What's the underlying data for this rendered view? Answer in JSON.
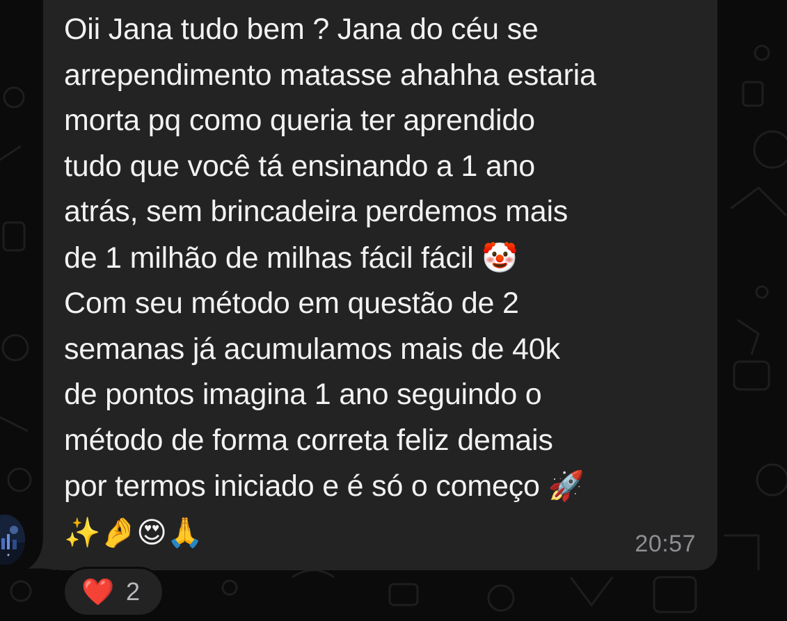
{
  "message": {
    "lines": [
      "Oii Jana tudo bem ? Jana do céu se",
      "arrependimento matasse ahahha estaria",
      "morta pq como queria ter aprendido",
      "tudo que você tá ensinando a 1 ano",
      "atrás, sem brincadeira perdemos mais",
      "de 1 milhão de milhas fácil fácil",
      "Com seu método em questão de 2",
      "semanas já acumulamos mais de 40k",
      "de pontos imagina 1 ano seguindo o",
      "método de forma correta feliz demais",
      "por termos iniciado e é só o começo"
    ],
    "emoji_clown": "🤡",
    "emoji_rocket": "🚀",
    "emoji_tail": "✨🤌😍🙏",
    "time": "20:57"
  },
  "reaction": {
    "emoji": "❤️",
    "count": "2"
  },
  "icons": {
    "avatar": "contact-avatar",
    "wallpaper": "chat-doodle-wallpaper"
  },
  "colors": {
    "background": "#0b0b0c",
    "bubble": "#232324",
    "text": "#f2f2f2",
    "timestamp": "#8e8e93",
    "heart": "#e0212f"
  }
}
